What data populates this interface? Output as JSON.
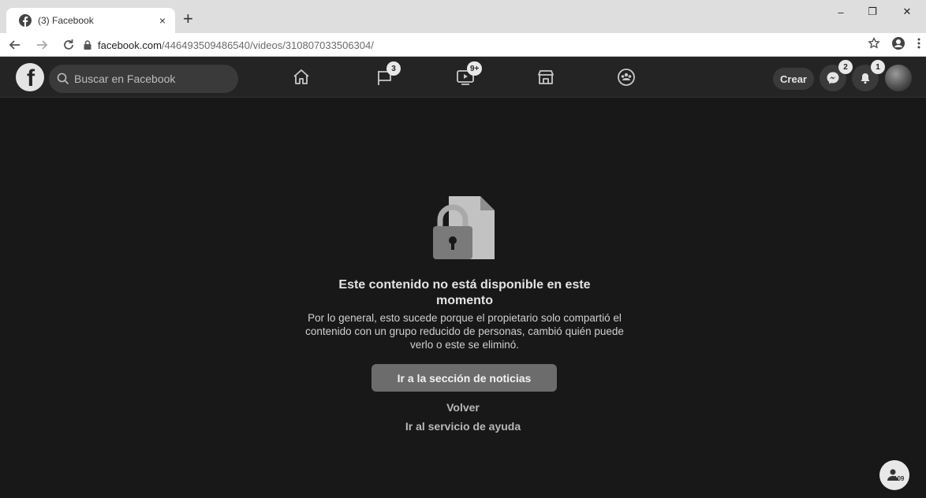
{
  "browser": {
    "tab_title": "(3) Facebook",
    "tab_close": "×",
    "new_tab": "+",
    "url_host": "facebook.com",
    "url_path": "/446493509486540/videos/310807033506304/",
    "win_minimize": "–",
    "win_restore": "❐",
    "win_close": "✕"
  },
  "header": {
    "logo_letter": "f",
    "search_placeholder": "Buscar en Facebook",
    "pages_badge": "3",
    "watch_badge": "9+",
    "create_label": "Crear",
    "messenger_badge": "2",
    "notifications_badge": "1"
  },
  "content": {
    "title": "Este contenido no está disponible en este momento",
    "body": "Por lo general, esto sucede porque el propietario solo compartió el contenido con un grupo reducido de personas, cambió quién puede verlo o este se eliminó.",
    "primary_button": "Ir a la sección de noticias",
    "back_link": "Volver",
    "help_link": "Ir al servicio de ayuda"
  },
  "floating": {
    "contacts_count": "109"
  },
  "colors": {
    "page_bg": "#181818",
    "header_bg": "#242424",
    "button_bg": "#6c6c6c"
  }
}
